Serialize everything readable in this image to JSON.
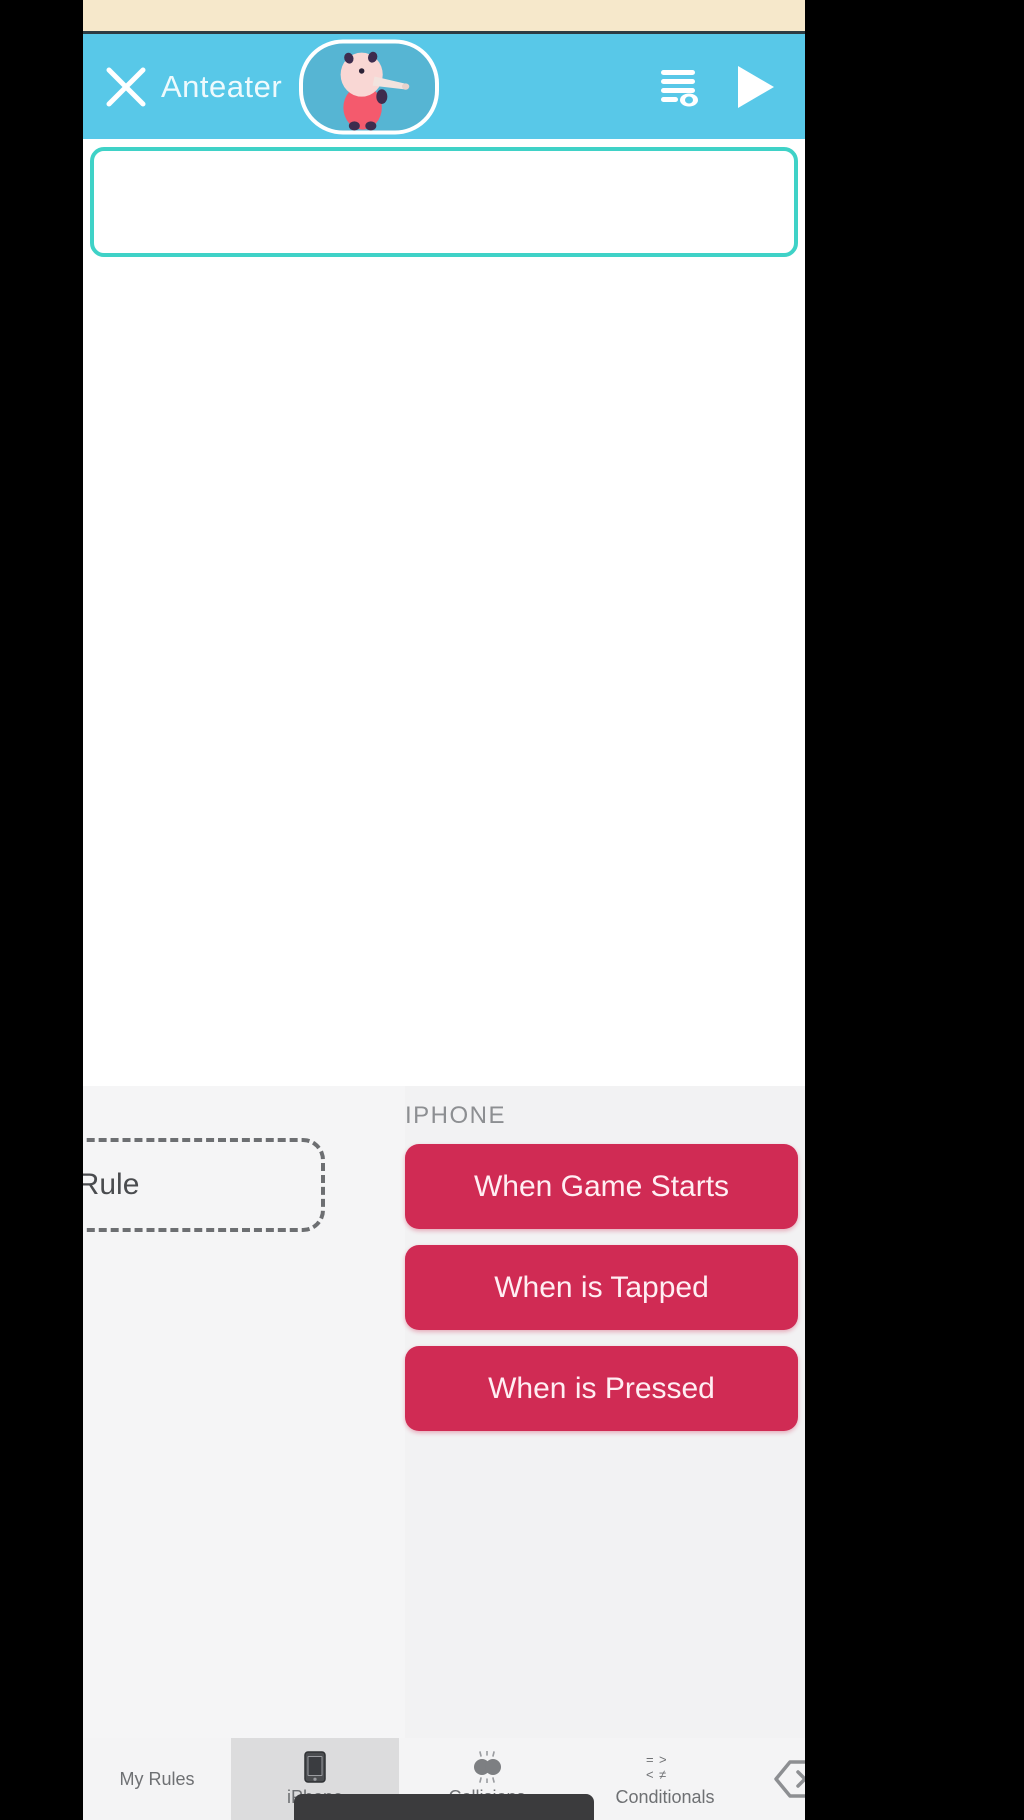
{
  "app": {
    "accent_blue": "#58c8e8",
    "accent_teal": "#3fd2c7",
    "accent_crimson": "#d02b54",
    "status_strip_color": "#f6e8cb"
  },
  "navbar": {
    "close_icon": "close-x-icon",
    "title": "Anteater",
    "avatar_icon": "anteater-character-avatar",
    "rules_icon": "rules-list-eye-icon",
    "play_icon": "play-triangle-icon"
  },
  "editor": {
    "rule_card_placeholder": ""
  },
  "drawer": {
    "my_rules": {
      "new_rule_label": "ew Rule"
    },
    "palette": {
      "heading": "IPHONE",
      "blocks": [
        {
          "label": "When Game Starts"
        },
        {
          "label": "When is Tapped"
        },
        {
          "label": "When is Pressed"
        }
      ]
    }
  },
  "tabbar": {
    "tabs": [
      {
        "label": "My Rules",
        "icon": "my-rules-icon",
        "selected": false
      },
      {
        "label": "iPhone",
        "icon": "iphone-device-icon",
        "selected": true
      },
      {
        "label": "Collisions",
        "icon": "collisions-icon",
        "selected": false
      },
      {
        "label": "Conditionals",
        "icon": "conditionals-icon",
        "selected": false
      }
    ],
    "delete_icon": "hexagon-delete-x-icon"
  }
}
